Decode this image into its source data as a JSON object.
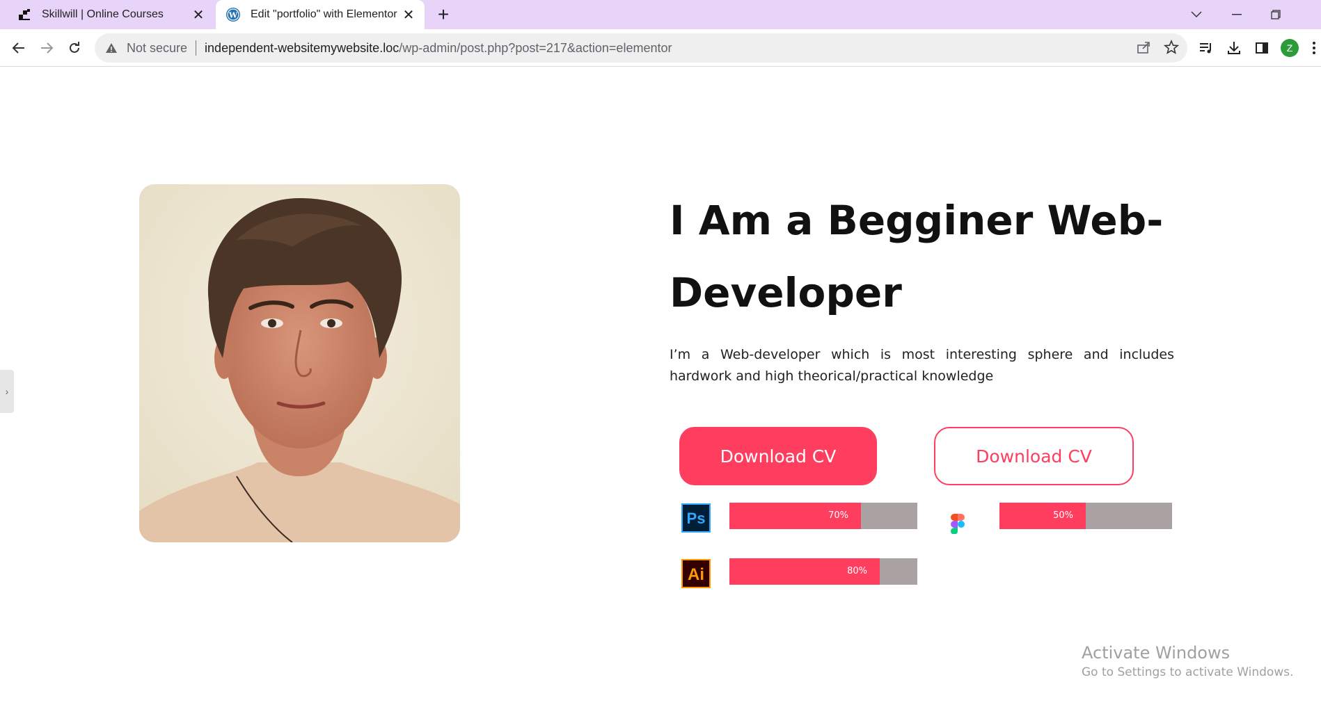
{
  "browser": {
    "tabs": [
      {
        "title": "Skillwill | Online Courses",
        "icon": "skillwill-icon",
        "active": false
      },
      {
        "title": "Edit \"portfolio\" with Elementor",
        "icon": "wordpress-icon",
        "active": true
      }
    ],
    "address": {
      "security_label": "Not secure",
      "host": "independent-websitemywebsite.loc",
      "path": "/wp-admin/post.php?post=217&action=elementor"
    },
    "profile_initial": "Z"
  },
  "hero": {
    "headline": "I Am a Begginer Web-Developer",
    "intro": "I’m a Web-developer which is most interesting sphere and includes hardwork and high theorical/practical knowledge",
    "buttons": {
      "primary_label": "Download CV",
      "secondary_label": "Download CV"
    }
  },
  "skills": [
    {
      "name": "Photoshop",
      "icon_text": "Ps",
      "percent_label": "70%",
      "value": 0.7
    },
    {
      "name": "Figma",
      "icon_text": "",
      "percent_label": "50%",
      "value": 0.5
    },
    {
      "name": "Illustrator",
      "icon_text": "Ai",
      "percent_label": "80%",
      "value": 0.8
    }
  ],
  "watermark": {
    "title": "Activate Windows",
    "subtitle": "Go to Settings to activate Windows."
  },
  "colors": {
    "accent": "#ff3d5f",
    "tabbar": "#e8d4f9",
    "bar_track": "#aaa2a2"
  }
}
